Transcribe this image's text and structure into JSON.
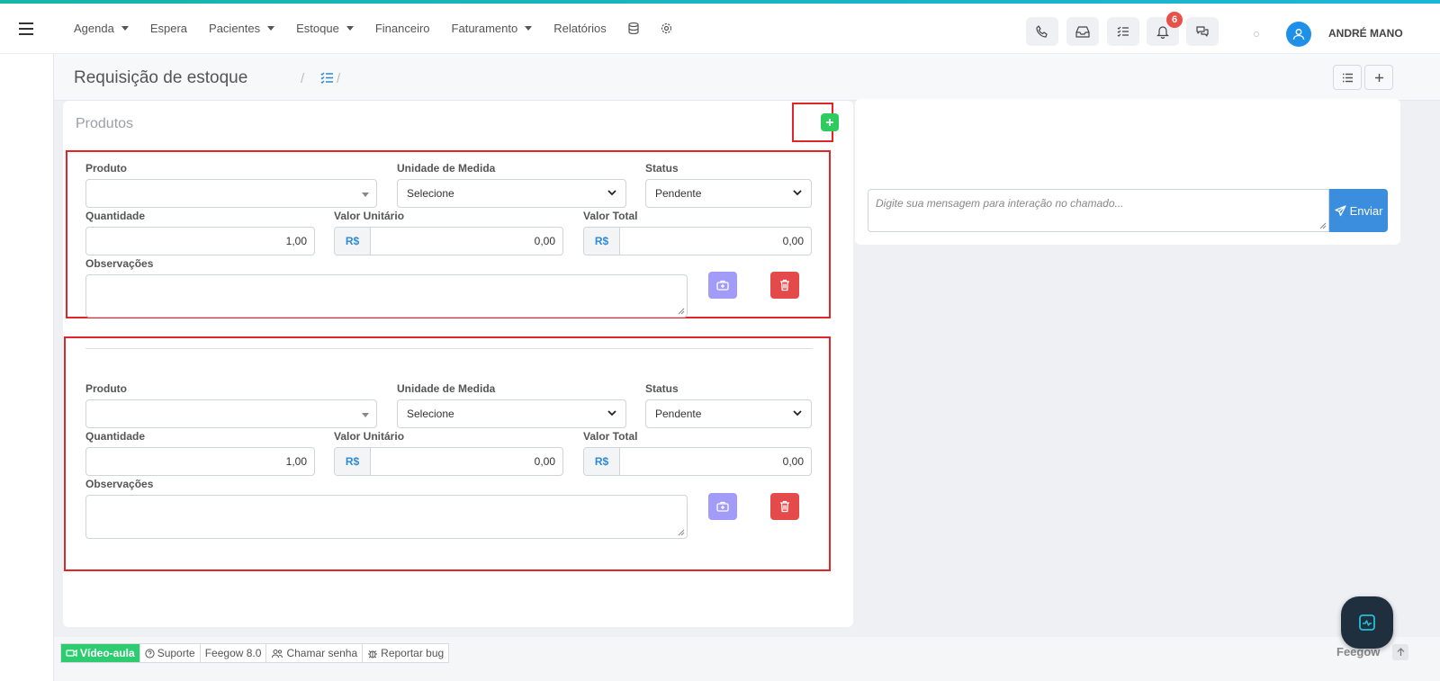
{
  "topbar": {
    "menu": [
      {
        "label": "Agenda",
        "has_caret": true
      },
      {
        "label": "Espera",
        "has_caret": false
      },
      {
        "label": "Pacientes",
        "has_caret": true
      },
      {
        "label": "Estoque",
        "has_caret": true
      },
      {
        "label": "Financeiro",
        "has_caret": false
      },
      {
        "label": "Faturamento",
        "has_caret": true
      },
      {
        "label": "Relatórios",
        "has_caret": false
      }
    ],
    "notification_count": "6",
    "user_name": "ANDRÉ MANO",
    "icons": [
      "phone-icon",
      "inbox-icon",
      "tasks-icon",
      "bell-icon",
      "chat-icon",
      "database-icon",
      "gear-icon"
    ]
  },
  "page": {
    "title": "Requisição de estoque",
    "breadcrumb_sep": "/"
  },
  "products": {
    "title": "Produtos",
    "labels": {
      "produto": "Produto",
      "unidade": "Unidade de Medida",
      "status": "Status",
      "quantidade": "Quantidade",
      "valor_unitario": "Valor Unitário",
      "valor_total": "Valor Total",
      "observacoes": "Observações"
    },
    "currency_prefix": "R$",
    "items": [
      {
        "produto": "",
        "unidade": "Selecione",
        "status": "Pendente",
        "quantidade": "1,00",
        "valor_unitario": "0,00",
        "valor_total": "0,00",
        "observacoes": ""
      },
      {
        "produto": "",
        "unidade": "Selecione",
        "status": "Pendente",
        "quantidade": "1,00",
        "valor_unitario": "0,00",
        "valor_total": "0,00",
        "observacoes": ""
      }
    ]
  },
  "chat": {
    "placeholder": "Digite sua mensagem para interação no chamado...",
    "send_label": "Enviar"
  },
  "footer": {
    "items": [
      "Vídeo-aula",
      "Suporte",
      "Feegow 8.0",
      "Chamar senha",
      "Reportar bug"
    ],
    "brand": "Feegow"
  },
  "colors": {
    "accent": "#1ab6d6",
    "add": "#2ecc5f",
    "danger": "#e44a4a",
    "secondary": "#a29bf8",
    "send": "#3b8dde",
    "highlight": "#e0252b"
  }
}
